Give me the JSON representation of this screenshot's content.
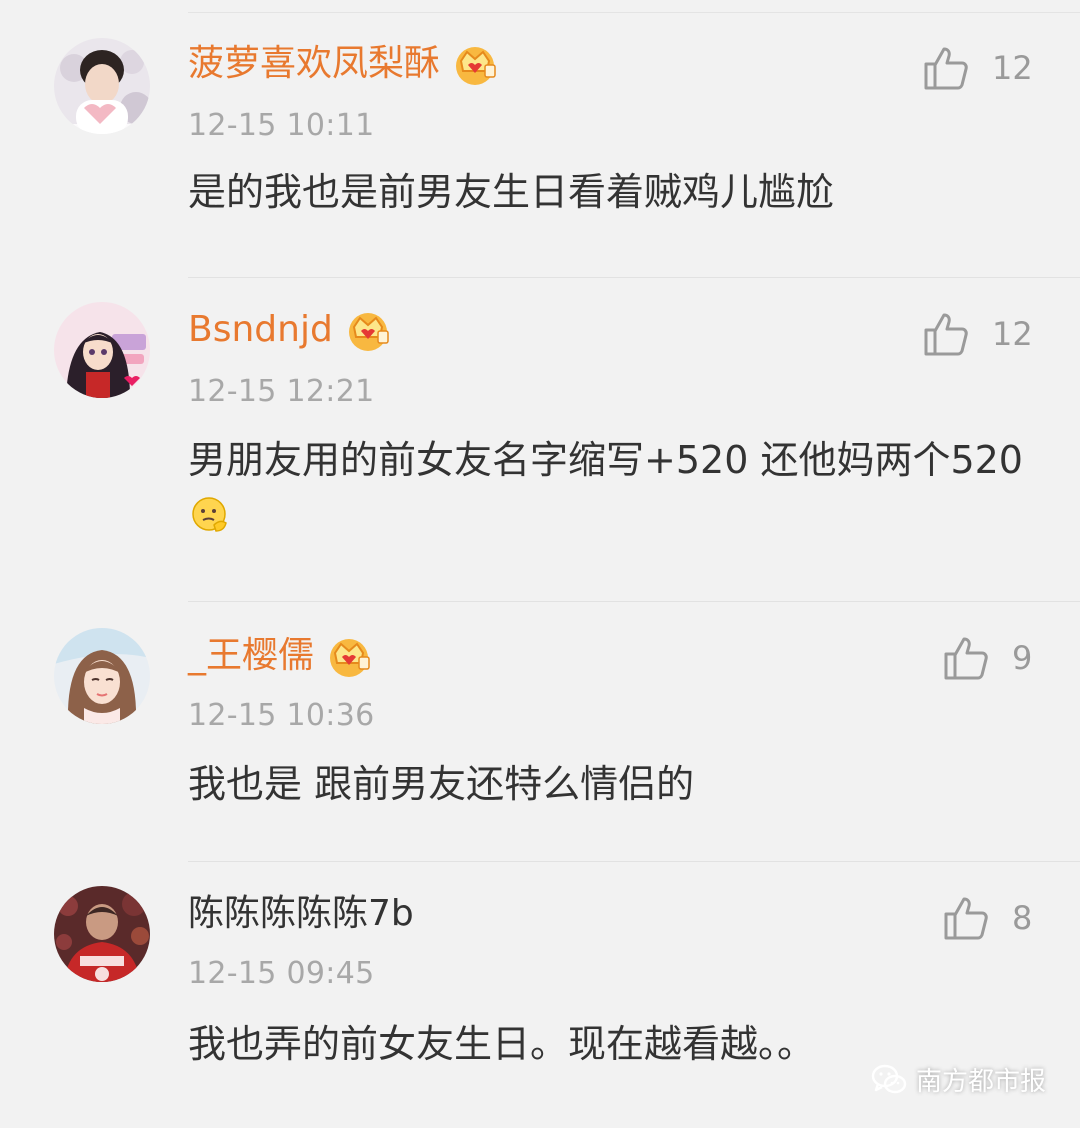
{
  "colors": {
    "background": "#f2f2f2",
    "vip_name": "#e8792f",
    "normal_name": "#333333",
    "time": "#a8a8a8",
    "like": "#9a9a9a"
  },
  "comments": [
    {
      "username": "菠萝喜欢凤梨酥",
      "vip": true,
      "time": "12-15 10:11",
      "likes": "12",
      "text": "是的我也是前男友生日看着贼鸡儿尴尬"
    },
    {
      "username": "Bsndnjd",
      "vip": true,
      "time": "12-15 12:21",
      "likes": "12",
      "text": "男朋友用的前女友名字缩写+520 还他妈两个520",
      "emoji": "thinking-face"
    },
    {
      "username": "_王樱儒",
      "vip": true,
      "time": "12-15 10:36",
      "likes": "9",
      "text": "我也是 跟前男友还特么情侣的"
    },
    {
      "username": "陈陈陈陈陈7b",
      "vip": false,
      "time": "12-15 09:45",
      "likes": "8",
      "text": "我也弄的前女友生日。现在越看越。。"
    }
  ],
  "watermark": {
    "text": "南方都市报",
    "icon": "wechat-icon"
  }
}
